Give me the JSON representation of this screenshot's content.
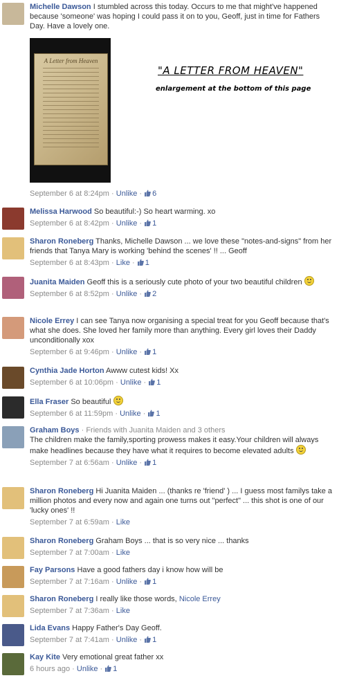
{
  "comments": [
    {
      "author": "Michelle Dawson",
      "text": "I stumbled across this today. Occurs to me that might've happened because 'someone' was hoping I could pass it on to you, Geoff, just in time for Fathers Day. Have a lovely one.",
      "time": "September 6 at 8:24pm",
      "action": "Unlike",
      "likes": "6",
      "avatar_color": "#c8b89a"
    },
    {
      "author": "Melissa Harwood",
      "text": "So beautiful:-) So heart warming. xo",
      "time": "September 6 at 8:42pm",
      "action": "Unlike",
      "likes": "1",
      "avatar_color": "#8b3a2e"
    },
    {
      "author": "Sharon Roneberg",
      "text": "Thanks, Michelle Dawson ... we love these \"notes-and-signs\" from her friends that Tanya Mary is working 'behind the scenes' !! ... Geoff",
      "time": "September 6 at 8:43pm",
      "action": "Like",
      "likes": "1",
      "avatar_color": "#e2c07a"
    },
    {
      "author": "Juanita Maiden",
      "text": "Geoff this is a seriously cute photo of your two beautiful children",
      "time": "September 6 at 8:52pm",
      "action": "Unlike",
      "likes": "2",
      "avatar_color": "#b0607a"
    },
    {
      "author": "Nicole Errey",
      "text": "I can see Tanya now organising a special treat for you Geoff because that's what she does. She loved her family more than anything. Every girl loves their Daddy unconditionally xox",
      "time": "September 6 at 9:46pm",
      "action": "Unlike",
      "likes": "1",
      "avatar_color": "#d49a7a"
    },
    {
      "author": "Cynthia Jade Horton",
      "text": "Awww cutest kids! Xx",
      "time": "September 6 at 10:06pm",
      "action": "Unlike",
      "likes": "1",
      "avatar_color": "#6a4a2a"
    },
    {
      "author": "Ella Fraser",
      "text": "So beautiful",
      "time": "September 6 at 11:59pm",
      "action": "Unlike",
      "likes": "1",
      "avatar_color": "#2b2b2b"
    },
    {
      "author": "Graham Boys",
      "friends_note": "· Friends with Juanita Maiden and 3 others",
      "text": "The children make the family,sporting prowess makes it easy.Your children will always make headlines because they have what it requires to become elevated adults",
      "time": "September 7 at 6:56am",
      "action": "Unlike",
      "likes": "1",
      "avatar_color": "#8aa0b8"
    },
    {
      "author": "Sharon Roneberg",
      "text": "Hi Juanita Maiden ... (thanks re 'friend' ) ... I guess most familys take a million photos and every now and again one turns out \"perfect\" ... this shot is one of our 'lucky ones' !!",
      "time": "September 7 at 6:59am",
      "action": "Like",
      "likes": "",
      "avatar_color": "#e2c07a"
    },
    {
      "author": "Sharon Roneberg",
      "text": "Graham Boys ... that is so very nice ... thanks",
      "time": "September 7 at 7:00am",
      "action": "Like",
      "likes": "",
      "avatar_color": "#e2c07a"
    },
    {
      "author": "Fay Parsons",
      "text": "Have a good fathers day i know how will be",
      "time": "September 7 at 7:16am",
      "action": "Unlike",
      "likes": "1",
      "avatar_color": "#c89a5a"
    },
    {
      "author": "Sharon Roneberg",
      "text": "I really like those words,",
      "text_link": "Nicole Errey",
      "time": "September 7 at 7:36am",
      "action": "Like",
      "likes": "",
      "avatar_color": "#e2c07a"
    },
    {
      "author": "Lida Evans",
      "text": "Happy Father's Day Geoff.",
      "time": "September 7 at 7:41am",
      "action": "Unlike",
      "likes": "1",
      "avatar_color": "#4a5a8a"
    },
    {
      "author": "Kay Kite",
      "text": "Very emotional great father xx",
      "time": "6 hours ago",
      "action": "Unlike",
      "likes": "1",
      "avatar_color": "#5a6a3a"
    }
  ],
  "photo": {
    "title": "A Letter from Heaven",
    "caption_title": "\"A LETTER FROM HEAVEN\"",
    "caption_sub": "enlargement at the bottom of this page"
  },
  "separator": "·"
}
